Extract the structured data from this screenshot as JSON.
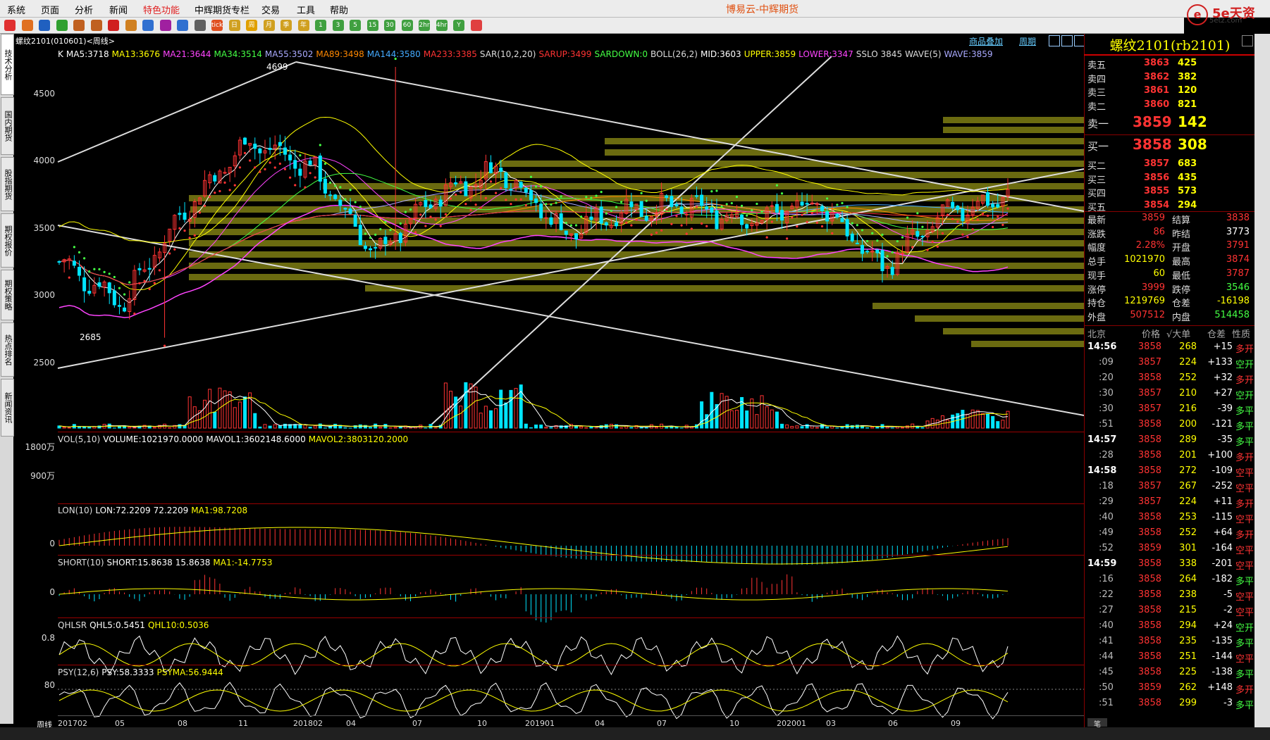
{
  "menu": {
    "items": [
      "系统",
      "页面",
      "分析",
      "新闻",
      "特色功能",
      "中辉期货专栏",
      "交易",
      "工具",
      "帮助"
    ],
    "app_title": "博易云-中辉期货"
  },
  "logo": {
    "text": "5e天资",
    "sub": "5etz.com",
    "mark": "e"
  },
  "toolbar": {
    "icons": [
      "back-icon",
      "home-icon",
      "forward-icon",
      "refresh-icon",
      "zoom-in-icon",
      "zoom-out-icon",
      "draw-icon",
      "pen-icon",
      "eraser-icon",
      "pin-icon",
      "zoom-icon",
      "table-icon",
      "tick-icon",
      "day-icon",
      "week-icon",
      "month-icon",
      "quarter-icon",
      "year-icon",
      "1min-icon",
      "3min-icon",
      "5min-icon",
      "15min-icon",
      "30min-icon",
      "60min-icon",
      "2hr-icon",
      "4hr-icon",
      "y-icon",
      "calc-icon"
    ],
    "labels": [
      "",
      "",
      "",
      "",
      "",
      "",
      "",
      "",
      "",
      "",
      "",
      "",
      "tick",
      "日",
      "周",
      "月",
      "季",
      "年",
      "1",
      "3",
      "5",
      "15",
      "30",
      "60",
      "2hr",
      "4hr",
      "Y",
      ""
    ]
  },
  "left_tabs": [
    {
      "label": "技术分析",
      "active": true
    },
    {
      "label": "国内期货",
      "active": false
    },
    {
      "label": "股指期货",
      "active": false
    },
    {
      "label": "期权报价",
      "active": false
    },
    {
      "label": "期权策略",
      "active": false
    },
    {
      "label": "热点排名",
      "active": false
    },
    {
      "label": "新闻资讯",
      "active": false
    }
  ],
  "chart_header": {
    "symbol": "螺纹2101(010601)<周线>",
    "btn_overlay": "商品叠加",
    "btn_period": "周期"
  },
  "main_legend": [
    {
      "text": "K",
      "color": "#ffffff"
    },
    {
      "text": "MA5:3718",
      "color": "#ffffff"
    },
    {
      "text": "MA13:3676",
      "color": "#ffff00"
    },
    {
      "text": "MA21:3644",
      "color": "#ff44ff"
    },
    {
      "text": "MA34:3514",
      "color": "#44ff44"
    },
    {
      "text": "MA55:3502",
      "color": "#aaaaff"
    },
    {
      "text": "MA89:3498",
      "color": "#ff8800"
    },
    {
      "text": "MA144:3580",
      "color": "#44aaff"
    },
    {
      "text": "MA233:3385",
      "color": "#ff3333"
    },
    {
      "text": "SAR(10,2,20)",
      "color": "#dddddd"
    },
    {
      "text": "SARUP:3499",
      "color": "#ff3333"
    },
    {
      "text": "SARDOWN:0",
      "color": "#44ff44"
    },
    {
      "text": "BOLL(26,2)",
      "color": "#dddddd"
    },
    {
      "text": "MID:3603",
      "color": "#ffffff"
    },
    {
      "text": "UPPER:3859",
      "color": "#ffff00"
    },
    {
      "text": "LOWER:3347",
      "color": "#ff44ff"
    },
    {
      "text": "SSLO 3845",
      "color": "#dddddd"
    },
    {
      "text": "WAVE(5)",
      "color": "#dddddd"
    },
    {
      "text": "WAVE:3859",
      "color": "#aaaaff"
    }
  ],
  "price_axis": [
    "4500",
    "4000",
    "3500",
    "3000",
    "2500"
  ],
  "price_marks": {
    "high": "4699",
    "low": "2685"
  },
  "vol_legend": [
    {
      "text": "VOL(5,10)",
      "color": "#dddddd"
    },
    {
      "text": "VOLUME:1021970.0000",
      "color": "#ffffff"
    },
    {
      "text": "MAVOL1:3602148.6000",
      "color": "#ffffff"
    },
    {
      "text": "MAVOL2:3803120.2000",
      "color": "#ffff00"
    }
  ],
  "vol_axis": [
    "1800万",
    "900万"
  ],
  "lon_legend": [
    {
      "text": "LON(10)",
      "color": "#dddddd"
    },
    {
      "text": "LON:72.2209",
      "color": "#ffffff"
    },
    {
      "text": "72.2209",
      "color": "#ffffff"
    },
    {
      "text": "MA1:98.7208",
      "color": "#ffff00"
    }
  ],
  "lon_axis": [
    "0"
  ],
  "short_legend": [
    {
      "text": "SHORT(10)",
      "color": "#dddddd"
    },
    {
      "text": "SHORT:15.8638",
      "color": "#ffffff"
    },
    {
      "text": "15.8638",
      "color": "#ffffff"
    },
    {
      "text": "MA1:-14.7753",
      "color": "#ffff00"
    }
  ],
  "short_axis": [
    "0"
  ],
  "qhl_legend": [
    {
      "text": "QHLSR",
      "color": "#dddddd"
    },
    {
      "text": "QHL5:0.5451",
      "color": "#ffffff"
    },
    {
      "text": "QHL10:0.5036",
      "color": "#ffff00"
    }
  ],
  "qhl_axis": [
    "0.8"
  ],
  "psy_legend": [
    {
      "text": "PSY(12,6)",
      "color": "#dddddd"
    },
    {
      "text": "PSY:58.3333",
      "color": "#ffffff"
    },
    {
      "text": "PSYMA:56.9444",
      "color": "#ffff00"
    }
  ],
  "psy_axis": [
    "80"
  ],
  "x_axis": {
    "period": "周线",
    "labels": [
      "201702",
      "05",
      "08",
      "11",
      "201802",
      "04",
      "07",
      "10",
      "201901",
      "04",
      "07",
      "10",
      "202001",
      "03",
      "06",
      "09"
    ]
  },
  "quote": {
    "title": "螺纹2101(rb2101)",
    "asks": [
      {
        "label": "卖五",
        "price": "3863",
        "vol": "425"
      },
      {
        "label": "卖四",
        "price": "3862",
        "vol": "382"
      },
      {
        "label": "卖三",
        "price": "3861",
        "vol": "120"
      },
      {
        "label": "卖二",
        "price": "3860",
        "vol": "821"
      },
      {
        "label": "卖一",
        "price": "3859",
        "vol": "142"
      }
    ],
    "bids": [
      {
        "label": "买一",
        "price": "3858",
        "vol": "308"
      },
      {
        "label": "买二",
        "price": "3857",
        "vol": "683"
      },
      {
        "label": "买三",
        "price": "3856",
        "vol": "435"
      },
      {
        "label": "买四",
        "price": "3855",
        "vol": "573"
      },
      {
        "label": "买五",
        "price": "3854",
        "vol": "294"
      }
    ],
    "stats": [
      {
        "l1": "最新",
        "v1": "3859",
        "c1": "#ff3333",
        "l2": "结算",
        "v2": "3838",
        "c2": "#ff3333"
      },
      {
        "l1": "涨跌",
        "v1": "86",
        "c1": "#ff3333",
        "l2": "昨结",
        "v2": "3773",
        "c2": "#ffffff"
      },
      {
        "l1": "幅度",
        "v1": "2.28%",
        "c1": "#ff3333",
        "l2": "开盘",
        "v2": "3791",
        "c2": "#ff3333"
      },
      {
        "l1": "总手",
        "v1": "1021970",
        "c1": "#ffff00",
        "l2": "最高",
        "v2": "3874",
        "c2": "#ff3333"
      },
      {
        "l1": "现手",
        "v1": "60",
        "c1": "#ffff00",
        "l2": "最低",
        "v2": "3787",
        "c2": "#ff3333"
      },
      {
        "l1": "涨停",
        "v1": "3999",
        "c1": "#ff3333",
        "l2": "跌停",
        "v2": "3546",
        "c2": "#44ff44"
      },
      {
        "l1": "持仓",
        "v1": "1219769",
        "c1": "#ffff00",
        "l2": "仓差",
        "v2": "-16198",
        "c2": "#ffff00"
      },
      {
        "l1": "外盘",
        "v1": "507512",
        "c1": "#ff3333",
        "l2": "内盘",
        "v2": "514458",
        "c2": "#44ff44"
      }
    ],
    "tick_header": {
      "time": "北京",
      "price": "价格",
      "vol": "√大单",
      "oi": "仓差",
      "nature": "性质"
    },
    "ticks": [
      {
        "t": "14:56",
        "p": "3858",
        "v": "268",
        "oi": "+15",
        "n": "多开",
        "big": true
      },
      {
        "t": ":09",
        "p": "3857",
        "v": "224",
        "oi": "+133",
        "n": "空开",
        "big": false
      },
      {
        "t": ":20",
        "p": "3858",
        "v": "252",
        "oi": "+32",
        "n": "多开",
        "big": false
      },
      {
        "t": ":30",
        "p": "3857",
        "v": "210",
        "oi": "+27",
        "n": "空开",
        "big": false
      },
      {
        "t": ":30",
        "p": "3857",
        "v": "216",
        "oi": "-39",
        "n": "多平",
        "big": false
      },
      {
        "t": ":51",
        "p": "3858",
        "v": "200",
        "oi": "-121",
        "n": "多平",
        "big": false
      },
      {
        "t": "14:57",
        "p": "3858",
        "v": "289",
        "oi": "-35",
        "n": "多平",
        "big": true
      },
      {
        "t": ":28",
        "p": "3858",
        "v": "201",
        "oi": "+100",
        "n": "多开",
        "big": false
      },
      {
        "t": "14:58",
        "p": "3858",
        "v": "272",
        "oi": "-109",
        "n": "空平",
        "big": true
      },
      {
        "t": ":18",
        "p": "3857",
        "v": "267",
        "oi": "-252",
        "n": "空平",
        "big": false
      },
      {
        "t": ":29",
        "p": "3857",
        "v": "224",
        "oi": "+11",
        "n": "多开",
        "big": false
      },
      {
        "t": ":40",
        "p": "3858",
        "v": "253",
        "oi": "-115",
        "n": "空平",
        "big": false
      },
      {
        "t": ":49",
        "p": "3858",
        "v": "252",
        "oi": "+64",
        "n": "多开",
        "big": false
      },
      {
        "t": ":52",
        "p": "3859",
        "v": "301",
        "oi": "-164",
        "n": "空平",
        "big": false
      },
      {
        "t": "14:59",
        "p": "3858",
        "v": "338",
        "oi": "-201",
        "n": "空平",
        "big": true
      },
      {
        "t": ":16",
        "p": "3858",
        "v": "264",
        "oi": "-182",
        "n": "多平",
        "big": false
      },
      {
        "t": ":22",
        "p": "3858",
        "v": "238",
        "oi": "-5",
        "n": "空平",
        "big": false
      },
      {
        "t": ":27",
        "p": "3858",
        "v": "215",
        "oi": "-2",
        "n": "空平",
        "big": false
      },
      {
        "t": ":40",
        "p": "3858",
        "v": "294",
        "oi": "+24",
        "n": "空开",
        "big": false
      },
      {
        "t": ":41",
        "p": "3858",
        "v": "235",
        "oi": "-135",
        "n": "多平",
        "big": false
      },
      {
        "t": ":44",
        "p": "3858",
        "v": "251",
        "oi": "-144",
        "n": "空平",
        "big": false
      },
      {
        "t": ":45",
        "p": "3858",
        "v": "225",
        "oi": "-138",
        "n": "多平",
        "big": false
      },
      {
        "t": ":50",
        "p": "3859",
        "v": "262",
        "oi": "+148",
        "n": "多开",
        "big": false
      },
      {
        "t": ":51",
        "p": "3858",
        "v": "299",
        "oi": "-3",
        "n": "多平",
        "big": false
      }
    ],
    "footer_tab": "笔"
  },
  "colors": {
    "up": "#ff3333",
    "down": "#00e5ff",
    "ma5": "#ffffff",
    "ma13": "#ffff00",
    "ma21": "#ff44ff",
    "ma34": "#44ff44",
    "ma55": "#aaaaff",
    "ma89": "#ff8800",
    "ma144": "#44aaff",
    "ma233": "#ff3333",
    "sar_up": "#ff3333",
    "sar_down": "#44ff44",
    "volume_profile": "#6b6b10"
  },
  "chart_data": {
    "type": "candlestick",
    "period": "weekly",
    "symbol": "螺纹2101",
    "x_range": [
      "201702",
      "202010"
    ],
    "ylim": [
      2300,
      4800
    ],
    "series": [
      {
        "name": "close",
        "x_anchor": [
          "201702",
          "05",
          "08",
          "11",
          "201802",
          "04",
          "07",
          "10",
          "201901",
          "04",
          "07",
          "10",
          "202001",
          "03",
          "06",
          "09"
        ],
        "values": [
          3250,
          2950,
          3650,
          4150,
          3950,
          3300,
          3750,
          3950,
          3450,
          3650,
          3650,
          3550,
          3700,
          3200,
          3600,
          3740
        ]
      }
    ],
    "annotations": [
      "4699",
      "2685"
    ]
  }
}
